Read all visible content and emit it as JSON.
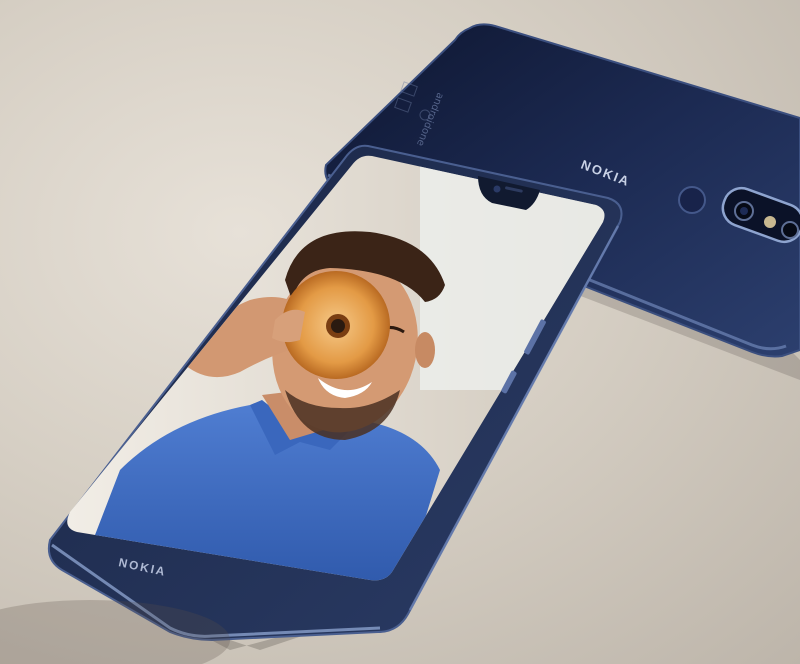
{
  "scene": {
    "description_free": true,
    "back_phone": {
      "brand": "NOKIA",
      "engraving": "androidone",
      "body_color": "#15203d",
      "accent_color": "#5b77a8"
    },
    "front_phone": {
      "brand": "NOKIA",
      "body_color": "#1a2747",
      "frame_color": "#3b4f7a"
    },
    "background_color": "#d9d2c7"
  }
}
